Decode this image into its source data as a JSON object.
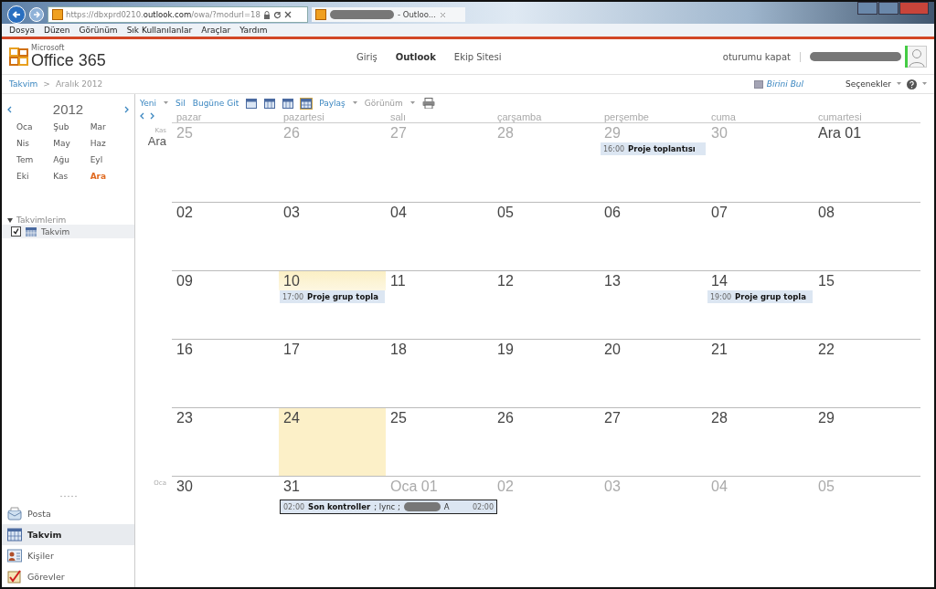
{
  "browser": {
    "url_scheme": "https://",
    "url_host_pre": "dbxprd0210.",
    "url_host": "outlook.com",
    "url_path": "/owa/?modurl=18",
    "tab_title": "- Outloo...",
    "menu": [
      "Dosya",
      "Düzen",
      "Görünüm",
      "Sık Kullanılanlar",
      "Araçlar",
      "Yardım"
    ]
  },
  "header": {
    "logo_small": "Microsoft",
    "logo": "Office 365",
    "nav": [
      {
        "label": "Giriş",
        "selected": false
      },
      {
        "label": "Outlook",
        "selected": true
      },
      {
        "label": "Ekip Sitesi",
        "selected": false
      }
    ],
    "signout": "oturumu kapat"
  },
  "breadcrumb": {
    "root": "Takvim",
    "sep": ">",
    "current": "Aralık 2012"
  },
  "find_person": "Birini Bul",
  "options": "Seçenekler",
  "mini_calendar": {
    "year": "2012",
    "months": [
      {
        "label": "Oca",
        "selected": false
      },
      {
        "label": "Şub",
        "selected": false
      },
      {
        "label": "Mar",
        "selected": false
      },
      {
        "label": "Nis",
        "selected": false
      },
      {
        "label": "May",
        "selected": false
      },
      {
        "label": "Haz",
        "selected": false
      },
      {
        "label": "Tem",
        "selected": false
      },
      {
        "label": "Ağu",
        "selected": false
      },
      {
        "label": "Eyl",
        "selected": false
      },
      {
        "label": "Eki",
        "selected": false
      },
      {
        "label": "Kas",
        "selected": false
      },
      {
        "label": "Ara",
        "selected": true
      }
    ]
  },
  "calendars": {
    "heading": "Takvimlerim",
    "expanded": true,
    "items": [
      {
        "label": "Takvim",
        "checked": true
      }
    ]
  },
  "nav": [
    {
      "label": "Posta",
      "kind": "mail",
      "selected": false
    },
    {
      "label": "Takvim",
      "kind": "calendar",
      "selected": true
    },
    {
      "label": "Kişiler",
      "kind": "contacts",
      "selected": false
    },
    {
      "label": "Görevler",
      "kind": "tasks",
      "selected": false
    }
  ],
  "toolbar": {
    "new": "Yeni",
    "delete": "Sil",
    "today": "Bugüne Git",
    "share": "Paylaş",
    "view": "Görünüm"
  },
  "weekdays": [
    "pazar",
    "pazartesi",
    "salı",
    "çarşamba",
    "perşembe",
    "cuma",
    "cumartesi"
  ],
  "weeks": [
    {
      "small_label": "Kas",
      "label": "Ara",
      "days": [
        {
          "date": "25",
          "other_month": true
        },
        {
          "date": "26",
          "other_month": true
        },
        {
          "date": "27",
          "other_month": true
        },
        {
          "date": "28",
          "other_month": true
        },
        {
          "date": "29",
          "other_month": true,
          "events": [
            {
              "time": "16:00",
              "title": "Proje toplantısı"
            }
          ]
        },
        {
          "date": "30",
          "other_month": true
        },
        {
          "date": "Ara 01",
          "other_month": false
        }
      ]
    },
    {
      "days": [
        {
          "date": "02"
        },
        {
          "date": "03"
        },
        {
          "date": "04"
        },
        {
          "date": "05"
        },
        {
          "date": "06"
        },
        {
          "date": "07"
        },
        {
          "date": "08"
        }
      ]
    },
    {
      "days": [
        {
          "date": "09"
        },
        {
          "date": "10",
          "selected": true,
          "events": [
            {
              "time": "17:00",
              "title": "Proje grup topla"
            }
          ]
        },
        {
          "date": "11"
        },
        {
          "date": "12"
        },
        {
          "date": "13"
        },
        {
          "date": "14",
          "events": [
            {
              "time": "19:00",
              "title": "Proje grup topla"
            }
          ]
        },
        {
          "date": "15"
        }
      ]
    },
    {
      "days": [
        {
          "date": "16"
        },
        {
          "date": "17"
        },
        {
          "date": "18"
        },
        {
          "date": "19"
        },
        {
          "date": "20"
        },
        {
          "date": "21"
        },
        {
          "date": "22"
        }
      ]
    },
    {
      "days": [
        {
          "date": "23"
        },
        {
          "date": "24",
          "today": true
        },
        {
          "date": "25"
        },
        {
          "date": "26"
        },
        {
          "date": "27"
        },
        {
          "date": "28"
        },
        {
          "date": "29"
        }
      ]
    },
    {
      "small_label": "Oca",
      "days": [
        {
          "date": "30"
        },
        {
          "date": "31",
          "events": [
            {
              "time": "02:00",
              "title": "Son kontroller",
              "extra": "; lync ;",
              "extra2": "A",
              "end_time": "02:00",
              "continues": true
            }
          ]
        },
        {
          "date": "Oca 01",
          "other_month": true
        },
        {
          "date": "02",
          "other_month": true
        },
        {
          "date": "03",
          "other_month": true
        },
        {
          "date": "04",
          "other_month": true
        },
        {
          "date": "05",
          "other_month": true
        }
      ]
    }
  ]
}
